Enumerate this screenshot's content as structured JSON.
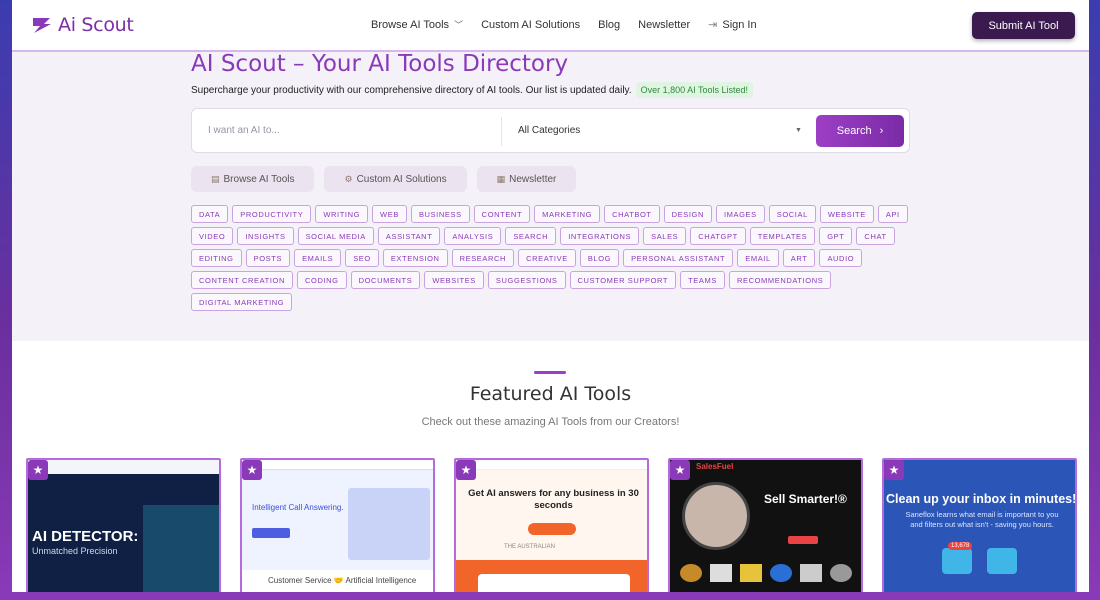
{
  "header": {
    "logo_text": "Ai Scout",
    "nav": [
      {
        "label": "Browse AI Tools",
        "has_dropdown": true
      },
      {
        "label": "Custom AI Solutions"
      },
      {
        "label": "Blog"
      },
      {
        "label": "Newsletter"
      },
      {
        "label": "Sign In",
        "icon": "sign-in-icon"
      }
    ],
    "submit_label": "Submit AI Tool"
  },
  "hero": {
    "title": "AI Scout – Your AI Tools Directory",
    "subtitle": "Supercharge your productivity with our comprehensive directory of AI tools. Our list is updated daily.",
    "badge": "Over 1,800 AI Tools Listed!"
  },
  "search": {
    "placeholder": "I want an AI to...",
    "category_selected": "All Categories",
    "button_label": "Search"
  },
  "quick_links": [
    {
      "label": "Browse AI Tools",
      "icon": "folder-icon"
    },
    {
      "label": "Custom AI Solutions",
      "icon": "gear-icon"
    },
    {
      "label": "Newsletter",
      "icon": "newspaper-icon"
    }
  ],
  "tags": [
    "DATA",
    "PRODUCTIVITY",
    "WRITING",
    "WEB",
    "BUSINESS",
    "CONTENT",
    "MARKETING",
    "CHATBOT",
    "DESIGN",
    "IMAGES",
    "SOCIAL",
    "WEBSITE",
    "API",
    "VIDEO",
    "INSIGHTS",
    "SOCIAL MEDIA",
    "ASSISTANT",
    "ANALYSIS",
    "SEARCH",
    "INTEGRATIONS",
    "SALES",
    "CHATGPT",
    "TEMPLATES",
    "GPT",
    "CHAT",
    "EDITING",
    "POSTS",
    "EMAILS",
    "SEO",
    "EXTENSION",
    "RESEARCH",
    "CREATIVE",
    "BLOG",
    "PERSONAL ASSISTANT",
    "EMAIL",
    "ART",
    "AUDIO",
    "CONTENT CREATION",
    "CODING",
    "DOCUMENTS",
    "WEBSITES",
    "SUGGESTIONS",
    "CUSTOMER SUPPORT",
    "TEAMS",
    "RECOMMENDATIONS",
    "DIGITAL MARKETING"
  ],
  "featured": {
    "title": "Featured AI Tools",
    "subtitle": "Check out these amazing AI Tools from our Creators!",
    "cards": [
      {
        "headline": "AI DETECTOR:",
        "subline": "Unmatched Precision"
      },
      {
        "headline": "Intelligent Call Answering.",
        "subline": "Customer Service 🤝 Artificial Intelligence"
      },
      {
        "headline": "Get AI answers for any business in 30 seconds",
        "subline": "THE AUSTRALIAN"
      },
      {
        "headline": "Sell Smarter!®",
        "subline": "SalesFuel"
      },
      {
        "headline": "Clean up your inbox in minutes!",
        "subline": "Saneflox learns what email is important to you and filters out what isn't - saving you hours.",
        "badge_count": "13,678"
      }
    ]
  },
  "colors": {
    "brand": "#8a3ab8",
    "submit_bg": "#3a1a4f",
    "badge_green": "#2f8a3d"
  }
}
